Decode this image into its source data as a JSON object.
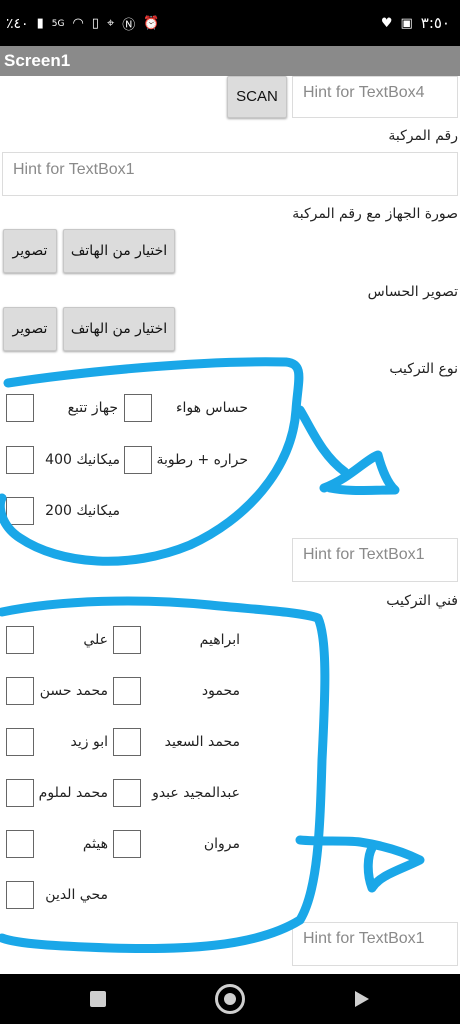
{
  "status_bar": {
    "battery_text": "٪٤٠",
    "network": "5G",
    "time": "٣:٥٠"
  },
  "app": {
    "title": "Screen1"
  },
  "scan_row": {
    "scan_label": "SCAN",
    "textbox4_hint": "Hint for TextBox4"
  },
  "vehicle": {
    "label": "رقم المركبة",
    "textbox1_hint": "Hint for TextBox1"
  },
  "device_photo": {
    "label": "صورة الجهاز مع رقم المركبة",
    "pick_label": "اختيار من الهاتف",
    "capture_label": "تصوير"
  },
  "sensor_photo": {
    "label": "تصوير الحساس",
    "pick_label": "اختيار من الهاتف",
    "capture_label": "تصوير"
  },
  "install_type": {
    "label": "نوع التركيب",
    "options": [
      "حساس هواء",
      "جهاز تتبع",
      "حراره + رطوبة",
      "ميكانيك 400",
      "ميكانيك 200"
    ],
    "other_hint": "Hint for TextBox1"
  },
  "technician": {
    "label": "فني التركيب",
    "options": [
      "ابراهيم",
      "علي",
      "محمود",
      "محمد حسن",
      "محمد السعيد",
      "ابو زيد",
      "عبدالمجيد عبدو",
      "محمد لملوم",
      "مروان",
      "هيثم",
      "محي الدين"
    ],
    "other_hint": "Hint for TextBox1"
  },
  "annotation_color": "#1aa7e8"
}
